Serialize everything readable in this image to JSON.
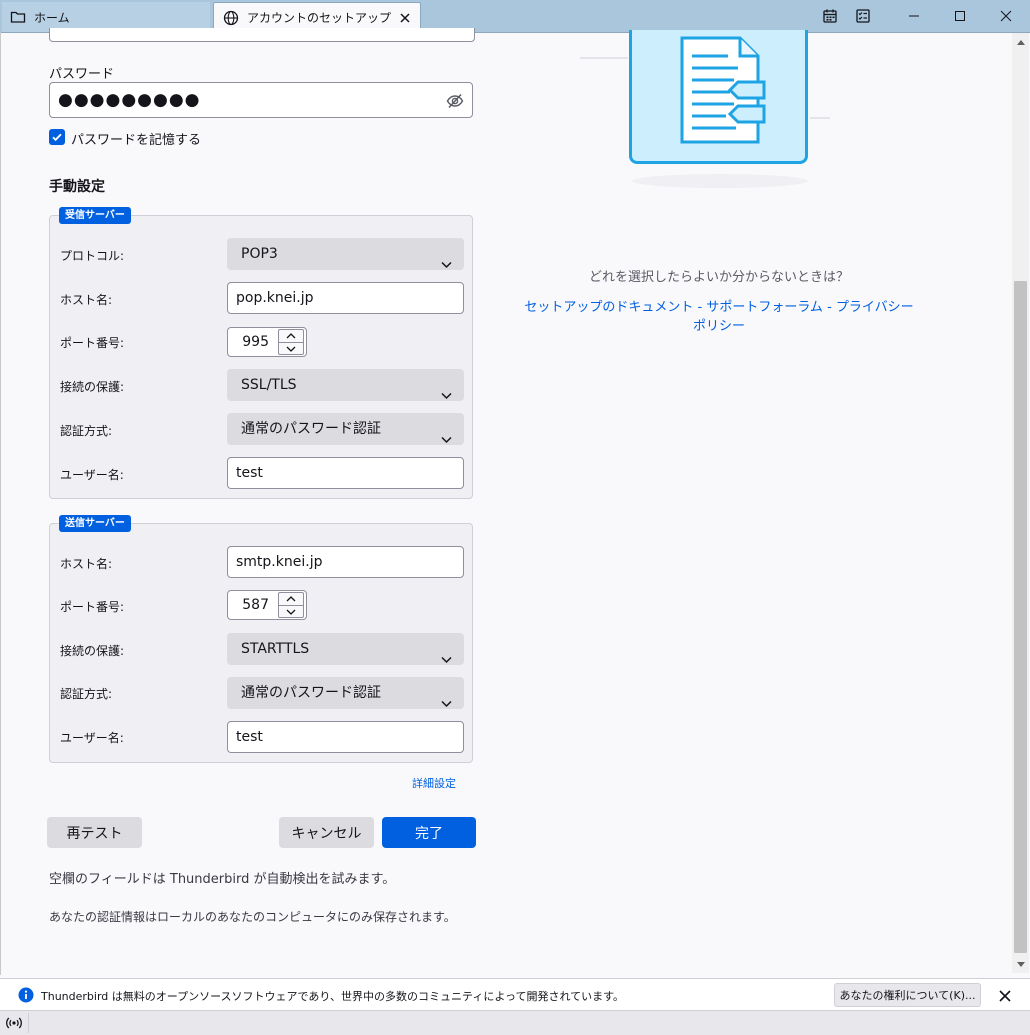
{
  "tabs": [
    {
      "label": "ホーム",
      "icon": "folder-icon"
    },
    {
      "label": "アカウントのセットアップ",
      "icon": "globe-icon"
    }
  ],
  "titlebar_icons": [
    "calendar-icon",
    "tasks-icon"
  ],
  "window_controls": [
    "minimize-icon",
    "maximize-icon",
    "close-icon"
  ],
  "form": {
    "password_label": "パスワード",
    "password_masked": "●●●●●●●●●",
    "remember_label": "パスワードを記憶する",
    "remember_checked": true,
    "manual_title": "手動設定",
    "incoming": {
      "tag": "受信サーバー",
      "protocol_label": "プロトコル:",
      "protocol_value": "POP3",
      "host_label": "ホスト名:",
      "host_value": "pop.knei.jp",
      "port_label": "ポート番号:",
      "port_value": "995",
      "security_label": "接続の保護:",
      "security_value": "SSL/TLS",
      "auth_label": "認証方式:",
      "auth_value": "通常のパスワード認証",
      "user_label": "ユーザー名:",
      "user_value": "test"
    },
    "outgoing": {
      "tag": "送信サーバー",
      "host_label": "ホスト名:",
      "host_value": "smtp.knei.jp",
      "port_label": "ポート番号:",
      "port_value": "587",
      "security_label": "接続の保護:",
      "security_value": "STARTTLS",
      "auth_label": "認証方式:",
      "auth_value": "通常のパスワード認証",
      "user_label": "ユーザー名:",
      "user_value": "test"
    },
    "advanced_link": "詳細設定",
    "retest_button": "再テスト",
    "cancel_button": "キャンセル",
    "done_button": "完了",
    "note_autodetect": "空欄のフィールドは Thunderbird が自動検出を試みます。",
    "note_local": "あなたの認証情報はローカルのあなたのコンピュータにのみ保存されます。"
  },
  "help": {
    "question": "どれを選択したらよいか分からないときは？",
    "links": [
      "セットアップのドキュメント",
      "サポートフォーラム",
      "プライバシーポリシー"
    ],
    "separator": " - "
  },
  "notification": {
    "text": "Thunderbird は無料のオープンソースソフトウェアであり、世界中の多数のコミュニティによって開発されています。",
    "button": "あなたの権利について(K)..."
  },
  "colors": {
    "accent": "#0060df",
    "illustration_blue": "#1ea4e4",
    "illustration_fill": "#cdeefc"
  }
}
